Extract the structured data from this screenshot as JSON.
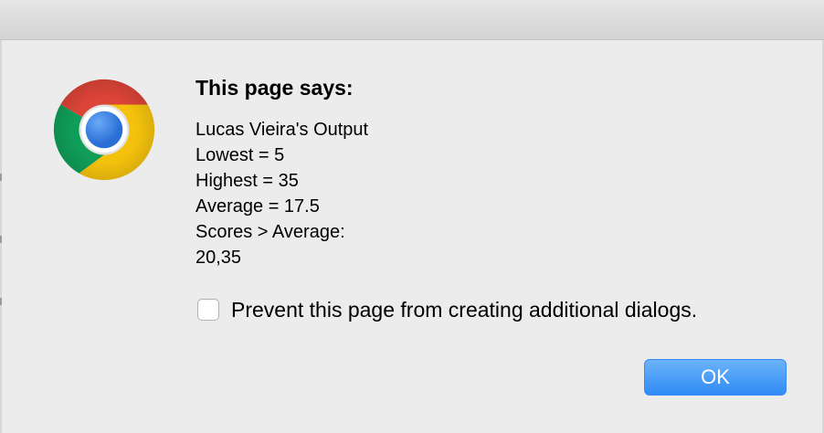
{
  "dialog": {
    "heading": "This page says:",
    "message_lines": [
      "Lucas Vieira's Output",
      "Lowest = 5",
      "Highest = 35",
      "Average = 17.5",
      "Scores > Average:",
      "20,35"
    ],
    "prevent_label": "Prevent this page from creating additional dialogs.",
    "prevent_checked": false,
    "ok_label": "OK",
    "icon": "chrome-logo-icon"
  },
  "colors": {
    "background": "#ececec",
    "button_blue": "#2f8bf5",
    "chrome_red": "#db4437",
    "chrome_green": "#0f9d58",
    "chrome_yellow": "#f4c20d",
    "chrome_blue": "#4285f4"
  }
}
